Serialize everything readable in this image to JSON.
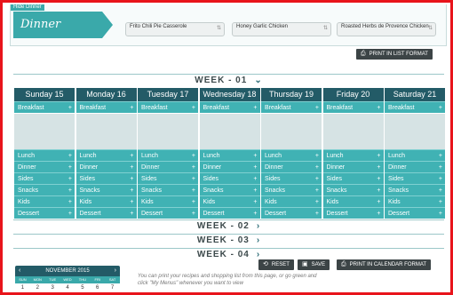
{
  "top": {
    "hide_label": "Hide Dinner",
    "title": "Dinner",
    "cards": [
      {
        "label": "Frito Chili Pie Casserole"
      },
      {
        "label": "Honey Garlic Chicken"
      },
      {
        "label": "Roasted Herbs de Provence Chicken"
      }
    ],
    "print_list": "PRINT IN LIST FORMAT"
  },
  "weeks": [
    "WEEK - 01",
    "WEEK - 02",
    "WEEK - 03",
    "WEEK - 04"
  ],
  "days": [
    {
      "name": "Sunday 15"
    },
    {
      "name": "Monday 16"
    },
    {
      "name": "Tuesday 17"
    },
    {
      "name": "Wednesday 18"
    },
    {
      "name": "Thursday 19"
    },
    {
      "name": "Friday 20"
    },
    {
      "name": "Saturday 21"
    }
  ],
  "meals": [
    "Breakfast",
    "Lunch",
    "Dinner",
    "Sides",
    "Snacks",
    "Kids",
    "Dessert"
  ],
  "actions": {
    "reset": "RESET",
    "save": "SAVE",
    "print_calendar": "PRINT IN CALENDAR FORMAT"
  },
  "mini_calendar": {
    "month": "NOVEMBER 2015",
    "weekdays": [
      "SUN",
      "MON",
      "TUE",
      "WED",
      "THU",
      "FRI",
      "SAT"
    ],
    "first_row": [
      "1",
      "2",
      "3",
      "4",
      "5",
      "6",
      "7"
    ]
  },
  "info_text": "You can print your recipes and shopping list from this page, or go green and click \"My Menus\" whenever you want to view",
  "colors": {
    "accent": "#3aa9aa",
    "header": "#235b67",
    "frame": "#e8141b"
  }
}
